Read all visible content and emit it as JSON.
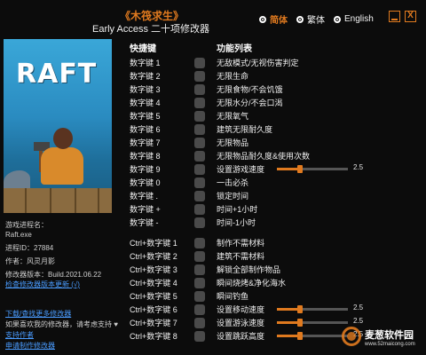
{
  "header": {
    "game_title": "《木筏求生》",
    "subtitle": "Early Access 二十项修改器",
    "languages": [
      {
        "label": "简体",
        "selected": true
      },
      {
        "label": "繁体",
        "selected": false
      },
      {
        "label": "English",
        "selected": false
      }
    ],
    "close_glyph": "X"
  },
  "cover": {
    "logo_text": "RAFT"
  },
  "info": {
    "process_name_label": "游戏进程名：",
    "process_name_value": "Raft.exe",
    "process_id": "进程ID：27884",
    "author": "作者：风灵月影",
    "version": "修改器版本：Build.2021.06.22",
    "check_update": "检查修改器版本更新 (√)"
  },
  "links": {
    "download_more": "下载/查找更多修改器",
    "support_note": "如果喜欢我的修改器，请考虑支持 ♥",
    "support_author": "支持作者",
    "request": "申请制作修改器"
  },
  "columns": {
    "hotkey": "快捷键",
    "functions": "功能列表"
  },
  "hotkeys": [
    {
      "key": "数字键 1",
      "func": "无敌模式/无视伤害判定"
    },
    {
      "key": "数字键 2",
      "func": "无限生命"
    },
    {
      "key": "数字键 3",
      "func": "无限食物/不会饥饿"
    },
    {
      "key": "数字键 4",
      "func": "无限水分/不会口渴"
    },
    {
      "key": "数字键 5",
      "func": "无限氧气"
    },
    {
      "key": "数字键 6",
      "func": "建筑无限耐久度"
    },
    {
      "key": "数字键 7",
      "func": "无限物品"
    },
    {
      "key": "数字键 8",
      "func": "无限物品耐久度&使用次数"
    },
    {
      "key": "数字键 9",
      "func": "设置游戏速度",
      "slider": 0.33,
      "value": "2.5"
    },
    {
      "key": "数字键 0",
      "func": "一击必杀"
    },
    {
      "key": "数字键 .",
      "func": "锁定时间"
    },
    {
      "key": "数字键 +",
      "func": "时间+1小时"
    },
    {
      "key": "数字键 -",
      "func": "时间-1小时"
    },
    {
      "key": "Ctrl+数字键 1",
      "func": "制作不需材料"
    },
    {
      "key": "Ctrl+数字键 2",
      "func": "建筑不需材料"
    },
    {
      "key": "Ctrl+数字键 3",
      "func": "解锁全部制作物品"
    },
    {
      "key": "Ctrl+数字键 4",
      "func": "瞬间烧烤&净化海水"
    },
    {
      "key": "Ctrl+数字键 5",
      "func": "瞬间钓鱼"
    },
    {
      "key": "Ctrl+数字键 6",
      "func": "设置移动速度",
      "slider": 0.33,
      "value": "2.5"
    },
    {
      "key": "Ctrl+数字键 7",
      "func": "设置游泳速度",
      "slider": 0.33,
      "value": "2.5"
    },
    {
      "key": "Ctrl+数字键 8",
      "func": "设置跳跃高度",
      "slider": 0.33,
      "value": "2.5"
    }
  ],
  "watermark": {
    "name": "麦葱软件园",
    "url": "www.52maicong.com"
  },
  "colors": {
    "accent": "#e07a1f",
    "link": "#4a9cff",
    "background": "#0c0c0c"
  }
}
